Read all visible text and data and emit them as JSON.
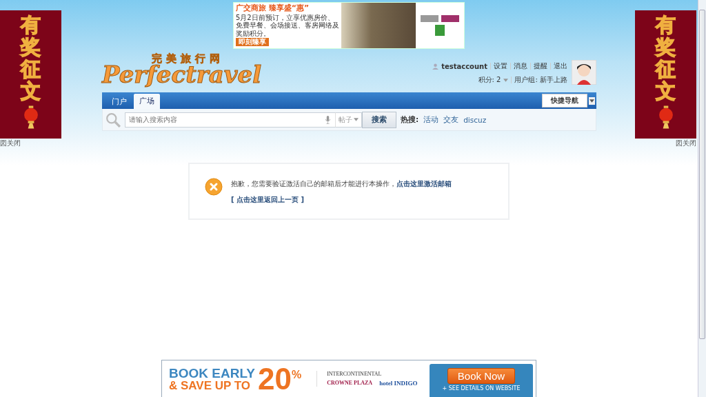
{
  "side_ads": [
    {
      "text": "有奖征文",
      "close": "図关闭"
    },
    {
      "text": "有奖征文",
      "close": "図关闭"
    }
  ],
  "top_ad": {
    "headline": "广交商旅 臻享盛“惠”",
    "body": "5月2日前预订，立享优惠房价、免费早餐、会场接送、客房网络及奖励积分。",
    "button": "即刻臻享"
  },
  "logo": {
    "cn": "完美旅行网",
    "en": "Perfectravel"
  },
  "user": {
    "name": "testaccount",
    "links": [
      "设置",
      "消息",
      "提醒",
      "退出"
    ],
    "points": "积分: 2",
    "group": "用户组: 新手上路"
  },
  "nav": {
    "tabs": [
      {
        "label": "门户",
        "selected": false
      },
      {
        "label": "广场",
        "selected": true
      }
    ],
    "quick_nav": "快捷导航"
  },
  "search": {
    "placeholder": "请输入搜索内容",
    "type": "帖子",
    "button": "搜索",
    "hot_label": "热搜:",
    "hot": [
      "活动",
      "交友",
      "discuz"
    ]
  },
  "message": {
    "text": "抱歉，您需要验证激活自己的邮箱后才能进行本操作，",
    "link": "点击这里激活邮箱",
    "back": "[ 点击这里返回上一页 ]"
  },
  "bottom_ad": {
    "headline": "BOOK EARLY",
    "subline": "& SAVE UP TO",
    "percent": "20",
    "percent_sign": "%",
    "brands": [
      "INTERCONTINENTAL",
      "CROWNE PLAZA",
      "hotel INDIGO"
    ],
    "button": "Book Now",
    "note": "+ SEE DETAILS ON WEBSITE"
  }
}
